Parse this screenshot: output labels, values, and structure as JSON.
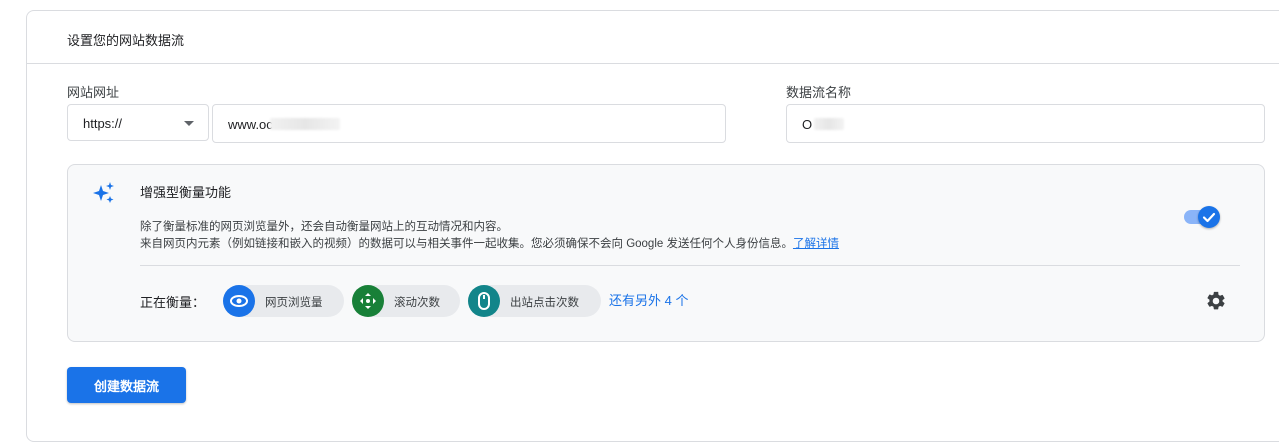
{
  "card": {
    "title": "设置您的网站数据流"
  },
  "form": {
    "url_label": "网站网址",
    "protocol": "https://",
    "url_value": "www.oc",
    "stream_name_label": "数据流名称",
    "stream_name_value": "O"
  },
  "enhanced": {
    "title": "增强型衡量功能",
    "desc_line1": "除了衡量标准的网页浏览量外，还会自动衡量网站上的互动情况和内容。",
    "desc_line2": "来自网页内元素（例如链接和嵌入的视频）的数据可以与相关事件一起收集。您必须确保不会向 Google 发送任何个人身份信息。",
    "learn_more": "了解详情",
    "toggle_on": true,
    "measuring_label": "正在衡量：",
    "chips": [
      {
        "label": "网页浏览量",
        "icon": "eye-icon",
        "color": "#1a73e8"
      },
      {
        "label": "滚动次数",
        "icon": "scroll-arrows-icon",
        "color": "#188038"
      },
      {
        "label": "出站点击次数",
        "icon": "mouse-icon",
        "color": "#12858a"
      }
    ],
    "more": "还有另外 4 个"
  },
  "actions": {
    "create_label": "创建数据流"
  },
  "colors": {
    "accent": "#1a73e8",
    "toggle_track": "#8ab4f8",
    "panel_bg": "#f8f9fa"
  }
}
